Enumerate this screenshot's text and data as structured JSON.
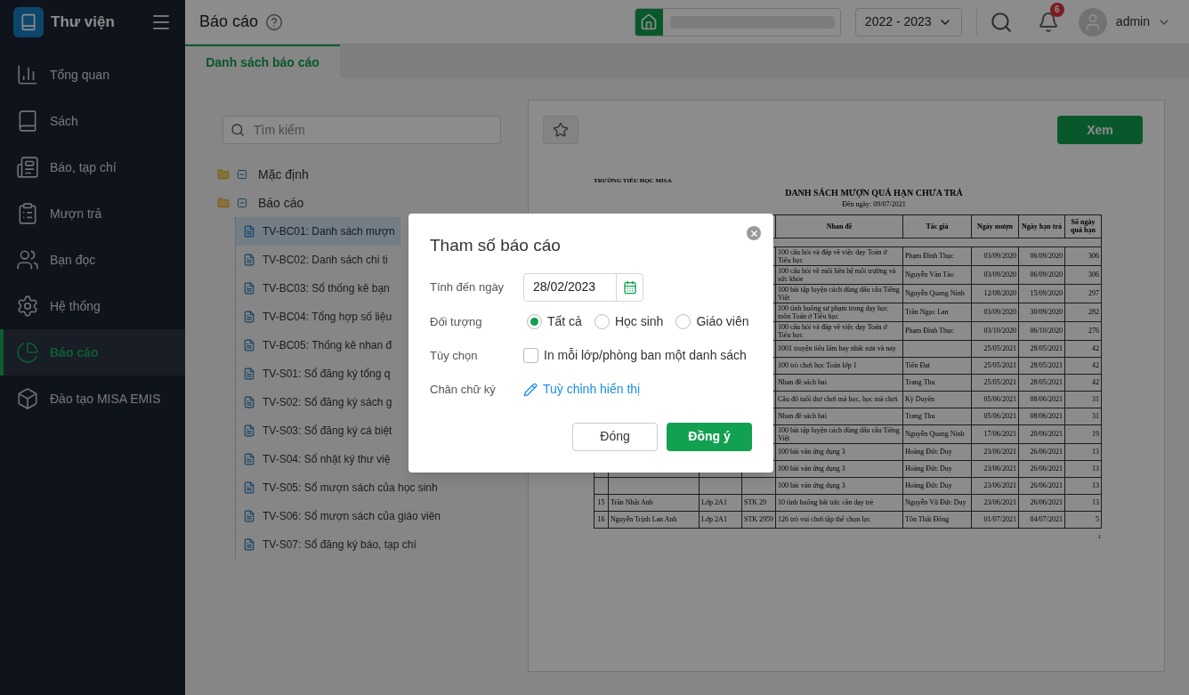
{
  "app": {
    "title": "Thư viện"
  },
  "sidebar": {
    "items": [
      {
        "label": "Tổng quan",
        "selected": false
      },
      {
        "label": "Sách",
        "selected": false
      },
      {
        "label": "Báo, tạp chí",
        "selected": false
      },
      {
        "label": "Mượn trả",
        "selected": false
      },
      {
        "label": "Bạn đọc",
        "selected": false
      },
      {
        "label": "Hệ thống",
        "selected": false
      },
      {
        "label": "Báo cáo",
        "selected": true
      },
      {
        "label": "Đào tạo MISA EMIS",
        "selected": false
      }
    ]
  },
  "header": {
    "title": "Báo cáo",
    "school_year": "2022 - 2023",
    "notifications": "6",
    "user": "admin"
  },
  "tabs": [
    {
      "label": "Danh sách báo cáo",
      "selected": true
    }
  ],
  "search": {
    "placeholder": "Tìm kiếm"
  },
  "tree": [
    {
      "label": "Mặc định",
      "expanded": true
    },
    {
      "label": "Báo cáo",
      "expanded": true,
      "children": [
        {
          "label": "TV-BC01: Danh sách mượn",
          "selected": true
        },
        {
          "label": "TV-BC02: Danh sách chi ti",
          "selected": false
        },
        {
          "label": "TV-BC03: Sổ thống kê bạn",
          "selected": false
        },
        {
          "label": "TV-BC04: Tổng hợp số liệu",
          "selected": false
        },
        {
          "label": "TV-BC05: Thống kê nhan đ",
          "selected": false
        },
        {
          "label": "TV-S01: Sổ đăng ký tổng q",
          "selected": false
        },
        {
          "label": "TV-S02: Sổ đăng ký sách g",
          "selected": false
        },
        {
          "label": "TV-S03: Sổ đăng ký cá biệt",
          "selected": false
        },
        {
          "label": "TV-S04: Sổ nhật ký thư việ",
          "selected": false
        },
        {
          "label": "TV-S05: Sổ mượn sách của học sinh",
          "selected": false
        },
        {
          "label": "TV-S06: Sổ mượn sách của giáo viên",
          "selected": false
        },
        {
          "label": "TV-S07: Sổ đăng ký báo, tạp chí",
          "selected": false
        }
      ]
    }
  ],
  "preview": {
    "view_button": "Xem",
    "report": {
      "school": "TRƯỜNG TIỂU HỌC MISA",
      "title": "DANH SÁCH MƯỢN QUÁ HẠN CHƯA TRẢ",
      "date_line": "Đến ngày: 09/07/2021",
      "columns": [
        "Nhan đề",
        "Tác giả",
        "Ngày mượn",
        "Ngày hạn trả",
        "Số ngày quá hạn"
      ],
      "rows": [
        {
          "title": "100 câu hỏi và đáp về việc dạy Toán ở Tiểu học",
          "author": "Phạm Đình Thục",
          "borrowed": "03/09/2020",
          "due": "06/09/2020",
          "overdue": "306"
        },
        {
          "title": "100 câu hỏi về mối liên hệ môi trường và sức khỏe",
          "author": "Nguyễn Văn Tảo",
          "borrowed": "03/09/2020",
          "due": "06/09/2020",
          "overdue": "306"
        },
        {
          "title": "100 bài tập luyện cách dùng dấu câu Tiếng Việt",
          "author": "Nguyễn Quang Ninh",
          "borrowed": "12/08/2020",
          "due": "15/09/2020",
          "overdue": "297"
        },
        {
          "title": "100 tình huống sư phạm trong dạy học môn Toán ở Tiểu học",
          "author": "Trần Ngọc Lan",
          "borrowed": "03/09/2020",
          "due": "30/09/2020",
          "overdue": "282"
        },
        {
          "title": "100 câu hỏi và đáp về việc dạy Toán ở Tiểu học",
          "author": "Phạm Đình Thục",
          "borrowed": "03/10/2020",
          "due": "06/10/2020",
          "overdue": "276"
        },
        {
          "title": "1001 truyện tiếu lâm hay nhất xưa và nay",
          "borrowed": "25/05/2021",
          "due": "28/05/2021",
          "overdue": "42"
        },
        {
          "title": "100 trò chơi học Toán lớp 1",
          "author": "Tiến Đạt",
          "borrowed": "25/05/2021",
          "due": "28/05/2021",
          "overdue": "42"
        },
        {
          "title": "Nhan đề sách hai",
          "author": "Trang Thu",
          "borrowed": "25/05/2021",
          "due": "28/05/2021",
          "overdue": "42"
        },
        {
          "title": "Câu đố tuổi thơ chơi mà học, học mà chơi",
          "author": "Kỳ Duyên",
          "borrowed": "05/06/2021",
          "due": "08/06/2021",
          "overdue": "31"
        },
        {
          "title": "Nhan đề sách hai",
          "author": "Trang Thu",
          "borrowed": "05/06/2021",
          "due": "08/06/2021",
          "overdue": "31"
        },
        {
          "title": "100 bài tập luyện cách dùng dấu câu Tiếng Việt",
          "author": "Nguyễn Quang Ninh",
          "borrowed": "17/06/2021",
          "due": "20/06/2021",
          "overdue": "19"
        },
        {
          "title": "100 bài văn ứng dụng 3",
          "author": "Hoàng Đức Duy",
          "borrowed": "23/06/2021",
          "due": "26/06/2021",
          "overdue": "13"
        },
        {
          "title": "100 bài văn ứng dụng 3",
          "author": "Hoàng Đức Duy",
          "borrowed": "23/06/2021",
          "due": "26/06/2021",
          "overdue": "13"
        },
        {
          "title": "100 bài văn ứng dụng 3",
          "author": "Hoàng Đức Duy",
          "borrowed": "23/06/2021",
          "due": "26/06/2021",
          "overdue": "13"
        },
        {
          "no": "15",
          "reader": "Trần Nhật Anh",
          "class": "Lớp 2A1",
          "code": "STK 29",
          "title": "10 tình huống bất trắc cần dạy trẻ",
          "author": "Nguyễn Vũ Đức Duy",
          "borrowed": "23/06/2021",
          "due": "26/06/2021",
          "overdue": "13"
        },
        {
          "no": "16",
          "reader": "Nguyễn Trịnh Lan Anh",
          "class": "Lớp 2A1",
          "code": "STK 2959",
          "title": "126 trò vui chơi tập thể chọn lọc",
          "author": "Tôn Thất Đông",
          "borrowed": "01/07/2021",
          "due": "04/07/2021",
          "overdue": "5"
        }
      ],
      "page": "1"
    }
  },
  "dialog": {
    "title": "Tham số báo cáo",
    "fields": [
      {
        "kind": "date",
        "label": "Tính đến ngày",
        "value": "28/02/2023"
      },
      {
        "kind": "radio",
        "label": "Đối tượng",
        "options": [
          {
            "label": "Tất cả",
            "selected": true
          },
          {
            "label": "Học sinh",
            "selected": false
          },
          {
            "label": "Giáo viên",
            "selected": false
          }
        ]
      },
      {
        "kind": "checkbox",
        "label": "Tùy chọn",
        "text": "In mỗi lớp/phòng ban một danh sách",
        "checked": false
      },
      {
        "kind": "link",
        "label": "Chân chữ ký",
        "text": "Tuỳ chỉnh hiển thị"
      }
    ],
    "buttons": [
      {
        "label": "Đóng",
        "kind": "secondary"
      },
      {
        "label": "Đồng ý",
        "kind": "primary"
      }
    ]
  }
}
